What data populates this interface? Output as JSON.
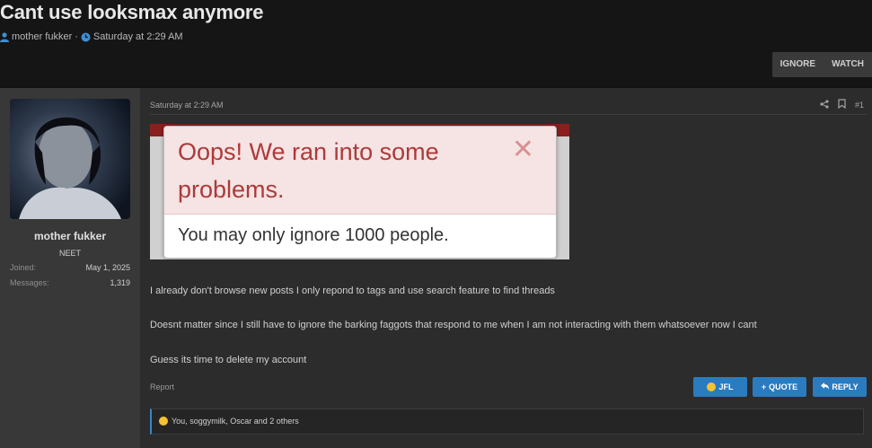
{
  "thread": {
    "title": "Cant use looksmax anymore",
    "author": "mother fukker",
    "separator": "·",
    "date": "Saturday at 2:29 AM"
  },
  "header_buttons": {
    "ignore": "IGNORE",
    "watch": "WATCH"
  },
  "user": {
    "name": "mother fukker",
    "title": "NEET",
    "joined_label": "Joined:",
    "joined_value": "May 1, 2025",
    "messages_label": "Messages:",
    "messages_value": "1,319"
  },
  "post": {
    "date": "Saturday at 2:29 AM",
    "number": "#1",
    "embedded_image": {
      "error_title": "Oops! We ran into some problems.",
      "close_glyph": "✕",
      "error_message": "You may only ignore 1000 people."
    },
    "paragraphs": [
      "I already don't browse new posts I only repond to tags and use search feature to find threads",
      "Doesnt matter since I still have to ignore the barking faggots that respond to me when I am not interacting with them whatsoever now I cant",
      "Guess its time to delete my account"
    ],
    "report": "Report",
    "buttons": {
      "jfl": "JFL",
      "quote": "QUOTE",
      "reply": "REPLY"
    },
    "reactions": "You, soggymilk, Oscar and 2 others"
  },
  "icons": {
    "user": "user-icon",
    "clock": "clock-icon",
    "share": "share-icon",
    "bookmark": "bookmark-icon",
    "emoji": "laughing-emoji-icon"
  },
  "colors": {
    "accent": "#2b7bbf",
    "error_title": "#ad3a3a",
    "error_bg": "#f6e3e3"
  }
}
